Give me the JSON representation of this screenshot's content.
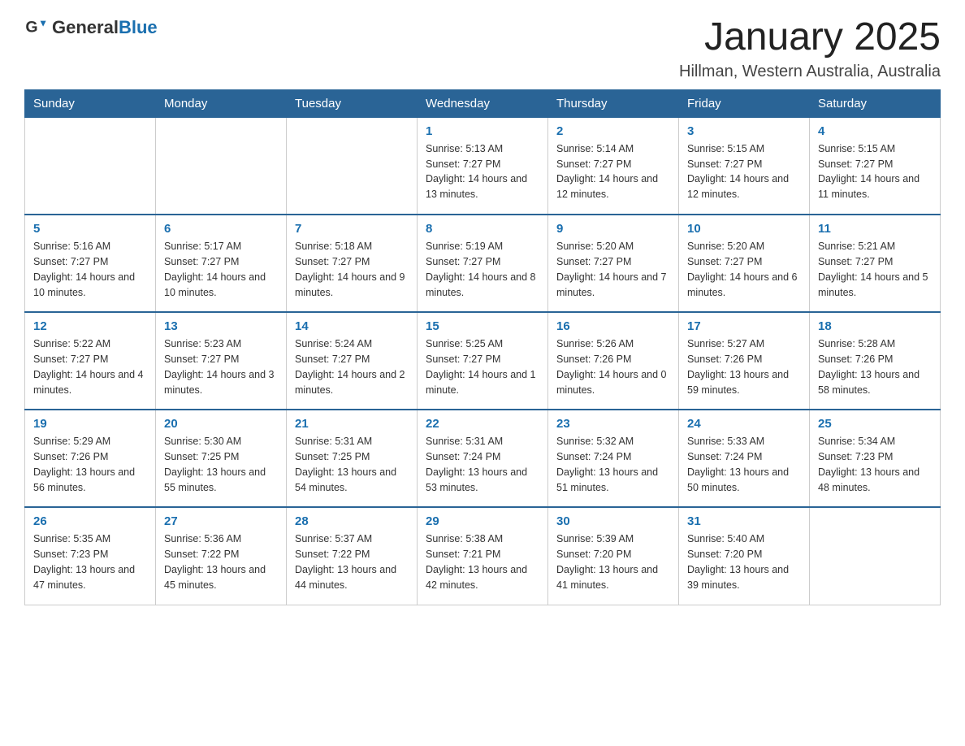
{
  "header": {
    "logo_general": "General",
    "logo_blue": "Blue",
    "month_title": "January 2025",
    "location": "Hillman, Western Australia, Australia"
  },
  "days_of_week": [
    "Sunday",
    "Monday",
    "Tuesday",
    "Wednesday",
    "Thursday",
    "Friday",
    "Saturday"
  ],
  "weeks": [
    [
      {
        "day": "",
        "info": ""
      },
      {
        "day": "",
        "info": ""
      },
      {
        "day": "",
        "info": ""
      },
      {
        "day": "1",
        "info": "Sunrise: 5:13 AM\nSunset: 7:27 PM\nDaylight: 14 hours and 13 minutes."
      },
      {
        "day": "2",
        "info": "Sunrise: 5:14 AM\nSunset: 7:27 PM\nDaylight: 14 hours and 12 minutes."
      },
      {
        "day": "3",
        "info": "Sunrise: 5:15 AM\nSunset: 7:27 PM\nDaylight: 14 hours and 12 minutes."
      },
      {
        "day": "4",
        "info": "Sunrise: 5:15 AM\nSunset: 7:27 PM\nDaylight: 14 hours and 11 minutes."
      }
    ],
    [
      {
        "day": "5",
        "info": "Sunrise: 5:16 AM\nSunset: 7:27 PM\nDaylight: 14 hours and 10 minutes."
      },
      {
        "day": "6",
        "info": "Sunrise: 5:17 AM\nSunset: 7:27 PM\nDaylight: 14 hours and 10 minutes."
      },
      {
        "day": "7",
        "info": "Sunrise: 5:18 AM\nSunset: 7:27 PM\nDaylight: 14 hours and 9 minutes."
      },
      {
        "day": "8",
        "info": "Sunrise: 5:19 AM\nSunset: 7:27 PM\nDaylight: 14 hours and 8 minutes."
      },
      {
        "day": "9",
        "info": "Sunrise: 5:20 AM\nSunset: 7:27 PM\nDaylight: 14 hours and 7 minutes."
      },
      {
        "day": "10",
        "info": "Sunrise: 5:20 AM\nSunset: 7:27 PM\nDaylight: 14 hours and 6 minutes."
      },
      {
        "day": "11",
        "info": "Sunrise: 5:21 AM\nSunset: 7:27 PM\nDaylight: 14 hours and 5 minutes."
      }
    ],
    [
      {
        "day": "12",
        "info": "Sunrise: 5:22 AM\nSunset: 7:27 PM\nDaylight: 14 hours and 4 minutes."
      },
      {
        "day": "13",
        "info": "Sunrise: 5:23 AM\nSunset: 7:27 PM\nDaylight: 14 hours and 3 minutes."
      },
      {
        "day": "14",
        "info": "Sunrise: 5:24 AM\nSunset: 7:27 PM\nDaylight: 14 hours and 2 minutes."
      },
      {
        "day": "15",
        "info": "Sunrise: 5:25 AM\nSunset: 7:27 PM\nDaylight: 14 hours and 1 minute."
      },
      {
        "day": "16",
        "info": "Sunrise: 5:26 AM\nSunset: 7:26 PM\nDaylight: 14 hours and 0 minutes."
      },
      {
        "day": "17",
        "info": "Sunrise: 5:27 AM\nSunset: 7:26 PM\nDaylight: 13 hours and 59 minutes."
      },
      {
        "day": "18",
        "info": "Sunrise: 5:28 AM\nSunset: 7:26 PM\nDaylight: 13 hours and 58 minutes."
      }
    ],
    [
      {
        "day": "19",
        "info": "Sunrise: 5:29 AM\nSunset: 7:26 PM\nDaylight: 13 hours and 56 minutes."
      },
      {
        "day": "20",
        "info": "Sunrise: 5:30 AM\nSunset: 7:25 PM\nDaylight: 13 hours and 55 minutes."
      },
      {
        "day": "21",
        "info": "Sunrise: 5:31 AM\nSunset: 7:25 PM\nDaylight: 13 hours and 54 minutes."
      },
      {
        "day": "22",
        "info": "Sunrise: 5:31 AM\nSunset: 7:24 PM\nDaylight: 13 hours and 53 minutes."
      },
      {
        "day": "23",
        "info": "Sunrise: 5:32 AM\nSunset: 7:24 PM\nDaylight: 13 hours and 51 minutes."
      },
      {
        "day": "24",
        "info": "Sunrise: 5:33 AM\nSunset: 7:24 PM\nDaylight: 13 hours and 50 minutes."
      },
      {
        "day": "25",
        "info": "Sunrise: 5:34 AM\nSunset: 7:23 PM\nDaylight: 13 hours and 48 minutes."
      }
    ],
    [
      {
        "day": "26",
        "info": "Sunrise: 5:35 AM\nSunset: 7:23 PM\nDaylight: 13 hours and 47 minutes."
      },
      {
        "day": "27",
        "info": "Sunrise: 5:36 AM\nSunset: 7:22 PM\nDaylight: 13 hours and 45 minutes."
      },
      {
        "day": "28",
        "info": "Sunrise: 5:37 AM\nSunset: 7:22 PM\nDaylight: 13 hours and 44 minutes."
      },
      {
        "day": "29",
        "info": "Sunrise: 5:38 AM\nSunset: 7:21 PM\nDaylight: 13 hours and 42 minutes."
      },
      {
        "day": "30",
        "info": "Sunrise: 5:39 AM\nSunset: 7:20 PM\nDaylight: 13 hours and 41 minutes."
      },
      {
        "day": "31",
        "info": "Sunrise: 5:40 AM\nSunset: 7:20 PM\nDaylight: 13 hours and 39 minutes."
      },
      {
        "day": "",
        "info": ""
      }
    ]
  ]
}
